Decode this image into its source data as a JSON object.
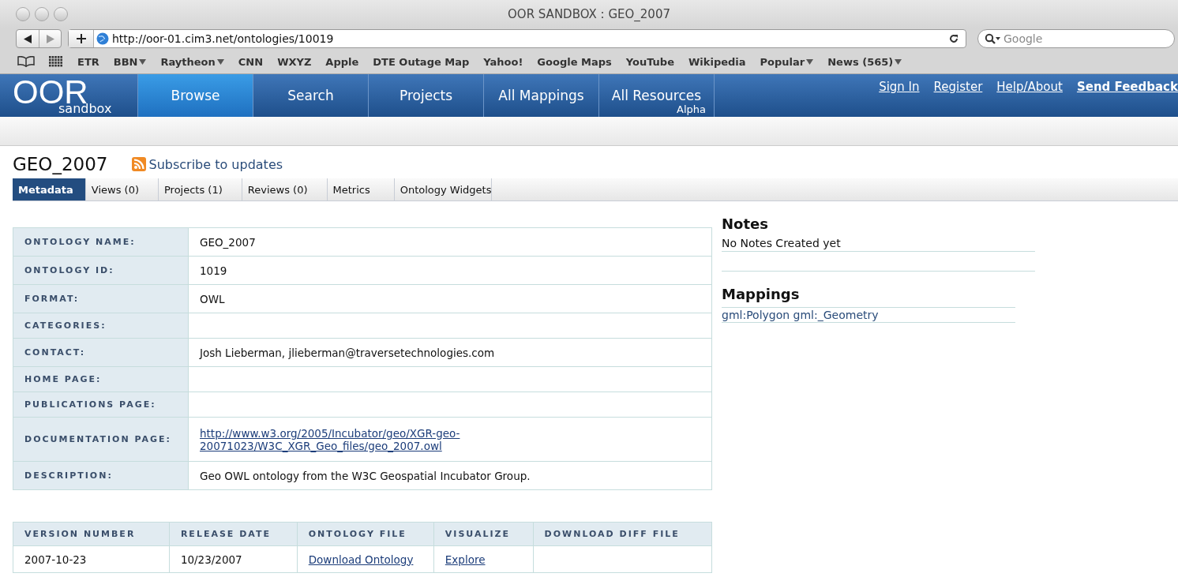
{
  "window": {
    "title": "OOR SANDBOX : GEO_2007"
  },
  "toolbar": {
    "url": "http://oor-01.cim3.net/ontologies/10019",
    "search_placeholder": "Google"
  },
  "bookmarks": [
    {
      "label": "ETR",
      "menu": false
    },
    {
      "label": "BBN",
      "menu": true
    },
    {
      "label": "Raytheon",
      "menu": true
    },
    {
      "label": "CNN",
      "menu": false
    },
    {
      "label": "WXYZ",
      "menu": false
    },
    {
      "label": "Apple",
      "menu": false
    },
    {
      "label": "DTE Outage Map",
      "menu": false
    },
    {
      "label": "Yahoo!",
      "menu": false
    },
    {
      "label": "Google Maps",
      "menu": false
    },
    {
      "label": "YouTube",
      "menu": false
    },
    {
      "label": "Wikipedia",
      "menu": false
    },
    {
      "label": "Popular",
      "menu": true
    },
    {
      "label": "News (565)",
      "menu": true
    }
  ],
  "site": {
    "logo": "OOR",
    "logo_sub": "sandbox",
    "nav": [
      {
        "label": "Browse",
        "selected": true
      },
      {
        "label": "Search",
        "selected": false
      },
      {
        "label": "Projects",
        "selected": false
      },
      {
        "label": "All Mappings",
        "selected": false
      },
      {
        "label": "All Resources",
        "sub": "Alpha",
        "selected": false
      }
    ],
    "links": [
      "Sign In",
      "Register",
      "Help/About",
      "Send Feedback"
    ]
  },
  "page": {
    "title": "GEO_2007",
    "subscribe": "Subscribe to updates",
    "tabs": [
      {
        "label": "Metadata",
        "selected": true
      },
      {
        "label": "Views (0)",
        "selected": false
      },
      {
        "label": "Projects (1)",
        "selected": false
      },
      {
        "label": "Reviews (0)",
        "selected": false
      },
      {
        "label": "Metrics",
        "selected": false
      },
      {
        "label": "Ontology Widgets",
        "selected": false
      }
    ],
    "metadata": [
      {
        "label": "ONTOLOGY NAME:",
        "value": "GEO_2007",
        "kind": "text"
      },
      {
        "label": "ONTOLOGY ID:",
        "value": "1019",
        "kind": "text"
      },
      {
        "label": "FORMAT:",
        "value": "OWL",
        "kind": "text"
      },
      {
        "label": "CATEGORIES:"
      },
      {
        "label": "CONTACT:",
        "value": "Josh Lieberman, jlieberman@traversetechnologies.com",
        "kind": "text"
      },
      {
        "label": "HOME PAGE:"
      },
      {
        "label": "PUBLICATIONS PAGE:"
      },
      {
        "label": "DOCUMENTATION PAGE:",
        "value": "http://www.w3.org/2005/Incubator/geo/XGR-geo-20071023/W3C_XGR_Geo_files/geo_2007.owl",
        "kind": "link"
      },
      {
        "label": "DESCRIPTION:",
        "value": "Geo OWL ontology from the W3C Geospatial Incubator Group.",
        "kind": "text"
      }
    ],
    "versions": {
      "columns": [
        "VERSION NUMBER",
        "RELEASE DATE",
        "ONTOLOGY FILE",
        "VISUALIZE",
        "DOWNLOAD DIFF FILE"
      ],
      "rows": [
        [
          {
            "value": "2007-10-23",
            "kind": "text"
          },
          {
            "value": "10/23/2007",
            "kind": "text"
          },
          {
            "value": "Download Ontology",
            "kind": "link"
          },
          {
            "value": "Explore",
            "kind": "link"
          },
          {}
        ]
      ]
    },
    "notes": {
      "title": "Notes",
      "text": "No Notes Created yet"
    },
    "mappings": {
      "title": "Mappings",
      "items": [
        "gml:Polygon gml:_Geometry"
      ]
    }
  }
}
